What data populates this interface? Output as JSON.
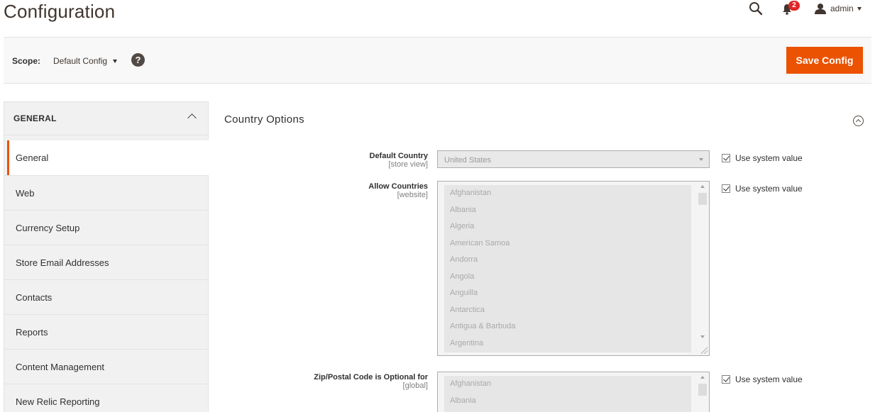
{
  "header": {
    "title": "Configuration",
    "notifications_count": "2",
    "user_name": "admin"
  },
  "scope_bar": {
    "scope_label": "Scope:",
    "scope_value": "Default Config",
    "help_symbol": "?",
    "save_label": "Save Config"
  },
  "sidebar": {
    "section_title": "GENERAL",
    "items": [
      {
        "label": "General",
        "active": true
      },
      {
        "label": "Web"
      },
      {
        "label": "Currency Setup"
      },
      {
        "label": "Store Email Addresses"
      },
      {
        "label": "Contacts"
      },
      {
        "label": "Reports"
      },
      {
        "label": "Content Management"
      },
      {
        "label": "New Relic Reporting"
      }
    ]
  },
  "section": {
    "title": "Country Options"
  },
  "fields": {
    "default_country": {
      "label": "Default Country",
      "scope": "[store view]",
      "value": "United States",
      "use_system_label": "Use system value",
      "use_system_checked": true
    },
    "allow_countries": {
      "label": "Allow Countries",
      "scope": "[website]",
      "options": [
        "Afghanistan",
        "Albania",
        "Algeria",
        "American Samoa",
        "Andorra",
        "Angola",
        "Anguilla",
        "Antarctica",
        "Antigua & Barbuda",
        "Argentina"
      ],
      "use_system_label": "Use system value",
      "use_system_checked": true
    },
    "zip_optional": {
      "label": "Zip/Postal Code is Optional for",
      "scope": "[global]",
      "options": [
        "Afghanistan",
        "Albania"
      ],
      "use_system_label": "Use system value",
      "use_system_checked": true
    }
  },
  "colors": {
    "accent": "#eb5202",
    "badge": "#e22626",
    "sidebar_bg": "#f1f1f1"
  }
}
